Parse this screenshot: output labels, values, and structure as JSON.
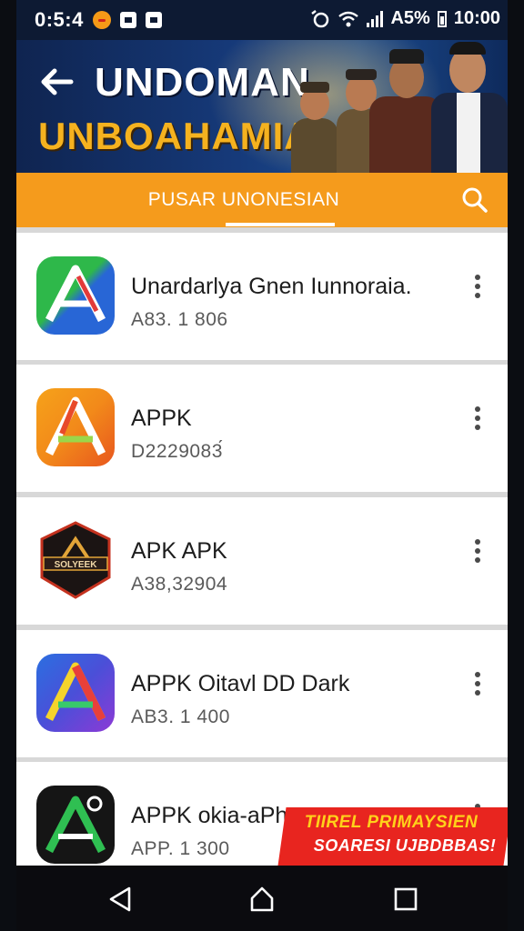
{
  "status_bar": {
    "time": "0:5:4",
    "right_text": "A5%",
    "clock": "10:00"
  },
  "banner": {
    "title": "UNDOMAN",
    "subtitle": "UNBOAHAMIAII"
  },
  "tab": {
    "label": "PUSAR UNONESIAN"
  },
  "apps": [
    {
      "name": "Unardarlya Gnen Iunnoraia.",
      "sub": "A83. 1 806",
      "icon": "app-icon-green-blue"
    },
    {
      "name": "APPK",
      "sub": "D2229083́",
      "icon": "app-icon-orange"
    },
    {
      "name": "APK APK",
      "sub": "A38,32904",
      "icon": "app-icon-dark-badge"
    },
    {
      "name": "APPK Oitavl DD Dark",
      "sub": "AB3. 1 400",
      "icon": "app-icon-blue-purple"
    },
    {
      "name": "APPK оkia-aPh",
      "sub": "APP. 1 300",
      "icon": "app-icon-black-green"
    }
  ],
  "badge_text": "SOLYEEK",
  "promo": {
    "line1": "TIIREL PRIMAYSIEN",
    "line2": "SOARESI UJBDBBAS!"
  },
  "colors": {
    "accent": "#f59b1c",
    "banner": "#163a7a",
    "promo": "#e8251f"
  }
}
